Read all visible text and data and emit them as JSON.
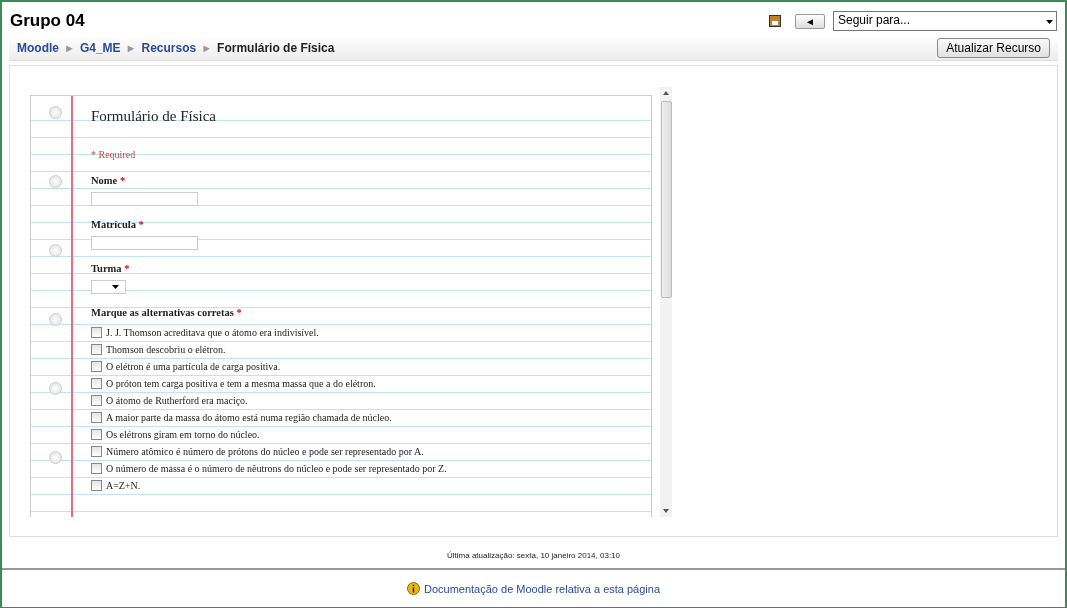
{
  "header": {
    "title": "Grupo 04",
    "back_button": "◄",
    "jump_select": {
      "value": "Seguir para..."
    }
  },
  "breadcrumb": {
    "items": [
      {
        "label": "Moodle",
        "link": true
      },
      {
        "label": "G4_ME",
        "link": true
      },
      {
        "label": "Recursos",
        "link": true
      },
      {
        "label": "Formulário de Física",
        "link": false
      }
    ],
    "separator": "►",
    "button": "Atualizar Recurso"
  },
  "form": {
    "title": "Formulário de Física",
    "required_note": "* Required",
    "fields": [
      {
        "kind": "text",
        "label": "Nome",
        "required": "*"
      },
      {
        "kind": "text",
        "label": "Matrícula",
        "required": "*"
      },
      {
        "kind": "select",
        "label": "Turma",
        "required": "*"
      },
      {
        "kind": "checkboxes",
        "label": "Marque as alternativas corretas",
        "required": "*",
        "options": [
          {
            "label": "J. J. Thomson acreditava que o átomo era indivisível.",
            "checked": false
          },
          {
            "label": "Thomson descobriu o elétron.",
            "checked": false
          },
          {
            "label": "O elétron é uma partícula de carga positiva.",
            "checked": false
          },
          {
            "label": "O próton tem carga positiva e tem a mesma massa que a do elétron.",
            "checked": false
          },
          {
            "label": "O átomo de Rutherford era maciço.",
            "checked": false
          },
          {
            "label": "A maior parte da massa do átomo está numa região chamada de núcleo.",
            "checked": false
          },
          {
            "label": "Os elétrons giram em torno do núcleo.",
            "checked": false
          },
          {
            "label": "Número atômico é número de prótons do núcleo e pode ser representado por A.",
            "checked": false
          },
          {
            "label": "O número de massa é o número de nêutrons do núcleo e pode ser representado por Z.",
            "checked": false
          },
          {
            "label": "A=Z+N.",
            "checked": false
          }
        ]
      }
    ]
  },
  "footer": {
    "last_update": "Última atualização: sexta, 10 janeiro 2014, 03:10",
    "doc_link": "Documentação de Moodle relativa a esta página"
  }
}
